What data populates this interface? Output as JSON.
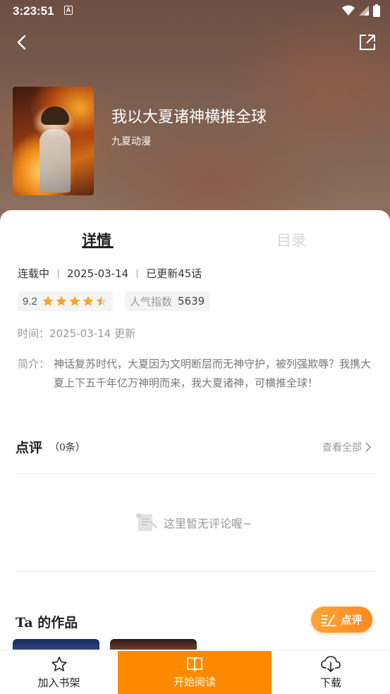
{
  "status_bar": {
    "time": "3:23:51",
    "indicator": "A",
    "icons": [
      "wifi-icon",
      "signal-icon",
      "battery-icon"
    ]
  },
  "nav": {
    "back_icon": "back-arrow-icon",
    "share_icon": "share-icon"
  },
  "book": {
    "title": "我以大夏诸神横推全球",
    "author": "九夏动漫"
  },
  "tabs": [
    {
      "label": "详情",
      "active": true
    },
    {
      "label": "目录",
      "active": false
    }
  ],
  "meta": {
    "status": "连载中",
    "date": "2025-03-14",
    "updates": "已更新45话"
  },
  "rating": {
    "score": "9.2",
    "stars": 4.5,
    "popularity_label": "人气指数",
    "popularity_value": "5639"
  },
  "detail": {
    "time_label": "时间：",
    "time_value": "2025-03-14 更新",
    "intro_label": "简介：",
    "intro_text": "神话复苏时代，大夏因为文明断层而无神守护，被列强欺辱？我携大夏上下五千年亿万神明而来，我大夏诸神，可横推全球！"
  },
  "reviews": {
    "title": "点评",
    "count": "（0条）",
    "view_all": "查看全部",
    "empty_text": "这里暂无评论喔~"
  },
  "works": {
    "title": "Ta 的作品"
  },
  "fab": {
    "label": "点评"
  },
  "bottom_bar": {
    "shelf": "加入书架",
    "read": "开始阅读",
    "download": "下载"
  },
  "colors": {
    "accent": "#ff8a00",
    "star": "#f5a623"
  }
}
